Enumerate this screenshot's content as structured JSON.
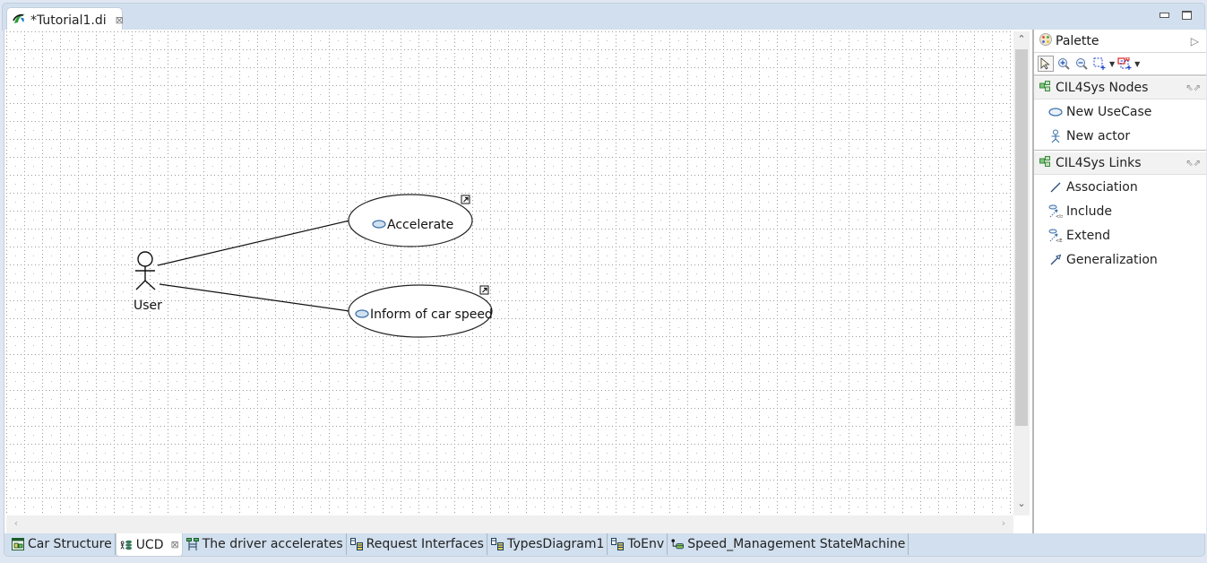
{
  "editor": {
    "tab_title": "*Tutorial1.di",
    "tab_icon": "papyrus-logo-icon",
    "close_glyph": "⊠"
  },
  "window_controls": {
    "minimize": "minimize-icon",
    "maximize": "maximize-icon"
  },
  "diagram": {
    "type": "UML Use Case Diagram",
    "actor": {
      "name": "User"
    },
    "use_cases": [
      {
        "name": "Accelerate",
        "badge": "shortcut-arrow-icon"
      },
      {
        "name": "Inform of car speed",
        "badge": "shortcut-arrow-icon"
      }
    ],
    "associations": [
      {
        "from": "User",
        "to": "Accelerate"
      },
      {
        "from": "User",
        "to": "Inform of car speed"
      }
    ]
  },
  "palette": {
    "title": "Palette",
    "toolbar": [
      "select-icon",
      "zoom-in-icon",
      "zoom-out-icon",
      "marquee-icon",
      "connection-marquee-icon"
    ],
    "drawers": [
      {
        "label": "CIL4Sys Nodes",
        "entries": [
          {
            "label": "New UseCase",
            "icon": "usecase-icon"
          },
          {
            "label": "New actor",
            "icon": "actor-icon"
          }
        ]
      },
      {
        "label": "CIL4Sys Links",
        "entries": [
          {
            "label": "Association",
            "icon": "association-icon"
          },
          {
            "label": "Include",
            "icon": "include-icon"
          },
          {
            "label": "Extend",
            "icon": "extend-icon"
          },
          {
            "label": "Generalization",
            "icon": "generalization-icon"
          }
        ]
      }
    ]
  },
  "bottom_tabs": [
    {
      "label": "Car Structure",
      "icon": "composite-diagram-icon",
      "active": false
    },
    {
      "label": "UCD",
      "icon": "usecase-diagram-icon",
      "active": true,
      "close_glyph": "⊠"
    },
    {
      "label": "The driver accelerates",
      "icon": "sequence-diagram-icon",
      "active": false
    },
    {
      "label": "Request Interfaces",
      "icon": "class-diagram-icon",
      "active": false
    },
    {
      "label": "TypesDiagram1",
      "icon": "class-diagram-icon",
      "active": false
    },
    {
      "label": "ToEnv",
      "icon": "class-diagram-icon",
      "active": false
    },
    {
      "label": "Speed_Management StateMachine",
      "icon": "statemachine-diagram-icon",
      "active": false
    }
  ],
  "colors": {
    "tab_strip": "#d1dfee",
    "usecase_fill": "#ffffff",
    "usecase_icon_fill": "#cfe0f0",
    "usecase_icon_stroke": "#3a6ea5"
  }
}
